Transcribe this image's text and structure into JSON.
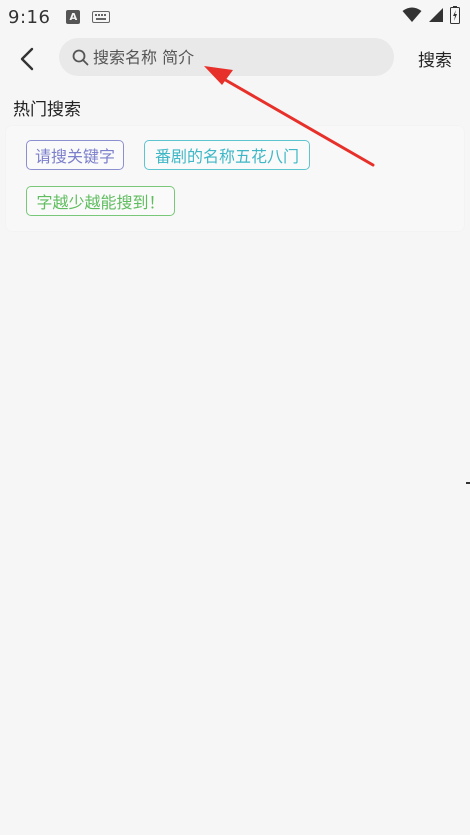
{
  "status_bar": {
    "time": "9:16",
    "a_badge": "A",
    "icons": [
      "a-notification-icon",
      "keyboard-icon",
      "wifi-icon",
      "signal-icon",
      "battery-icon"
    ]
  },
  "header": {
    "back_icon": "chevron-left-icon",
    "search_placeholder": "搜索名称 简介",
    "search_button": "搜索"
  },
  "hot_search": {
    "title": "热门搜索",
    "tags": [
      {
        "label": "请搜关键字",
        "color": "#7b7fcc"
      },
      {
        "label": "番剧的名称五花八门",
        "color": "#3fb7c6"
      },
      {
        "label": "字越少越能搜到！",
        "color": "#5fbd5f"
      }
    ]
  },
  "colors": {
    "background": "#f6f6f6",
    "search_box": "#e9e9e9",
    "annotation_arrow": "#e8302a"
  }
}
